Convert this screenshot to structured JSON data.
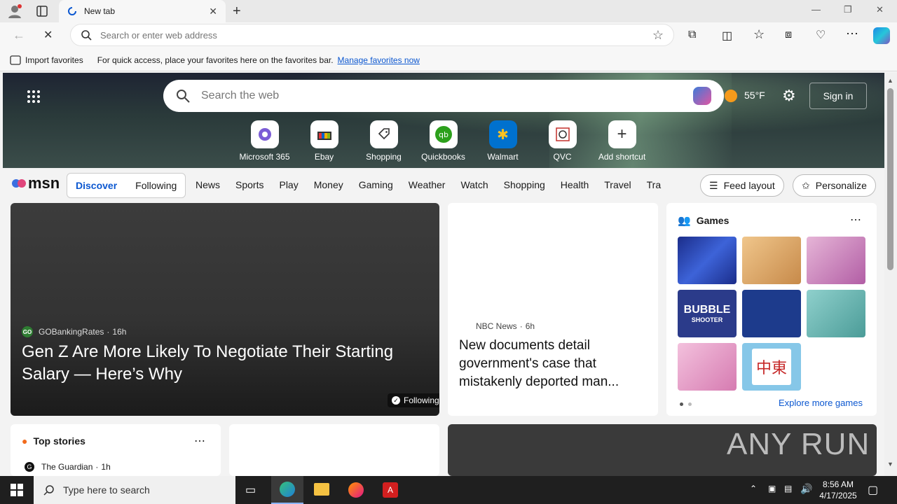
{
  "browser": {
    "tab_title": "New tab",
    "address_placeholder": "Search or enter web address",
    "favorites_bar": {
      "import_label": "Import favorites",
      "message": "For quick access, place your favorites here on the favorites bar.",
      "manage_link": "Manage favorites now"
    }
  },
  "hero": {
    "search_placeholder": "Search the web",
    "weather_temp": "55°F",
    "sign_in": "Sign in",
    "shortcuts": [
      {
        "label": "Microsoft 365"
      },
      {
        "label": "Ebay"
      },
      {
        "label": "Shopping"
      },
      {
        "label": "Quickbooks"
      },
      {
        "label": "Walmart"
      },
      {
        "label": "QVC"
      },
      {
        "label": "Add shortcut"
      }
    ]
  },
  "msn": {
    "logo": "msn",
    "toggle": {
      "discover": "Discover",
      "following": "Following"
    },
    "nav": [
      "News",
      "Sports",
      "Play",
      "Money",
      "Gaming",
      "Weather",
      "Watch",
      "Shopping",
      "Health",
      "Travel",
      "Tra"
    ],
    "feed_layout": "Feed layout",
    "personalize": "Personalize"
  },
  "cards": {
    "main": {
      "source": "GOBankingRates",
      "source_initials": "GO",
      "age": "16h",
      "headline": "Gen Z Are More Likely To Negotiate Their Starting Salary — Here’s Why",
      "following": "Following"
    },
    "nbc": {
      "source": "NBC News",
      "age": "6h",
      "headline": "New documents detail government's case that mistakenly deported man..."
    },
    "games": {
      "title": "Games",
      "explore": "Explore more games",
      "tile_texts": {
        "bubble": "BUBBLE",
        "shooter": "SHOOTER",
        "mahjong": "中東"
      },
      "colors": [
        "#2a3d9a",
        "#d9a060",
        "#c77bb8",
        "#2b3b8a",
        "#1d3b8c",
        "#7fc2c0",
        "#e9a9d0",
        "#ffffff"
      ]
    },
    "top_stories": {
      "title": "Top stories",
      "source": "The Guardian",
      "age": "1h"
    }
  },
  "watermark": "ANY RUN",
  "taskbar": {
    "search_placeholder": "Type here to search",
    "time": "8:56 AM",
    "date": "4/17/2025"
  }
}
